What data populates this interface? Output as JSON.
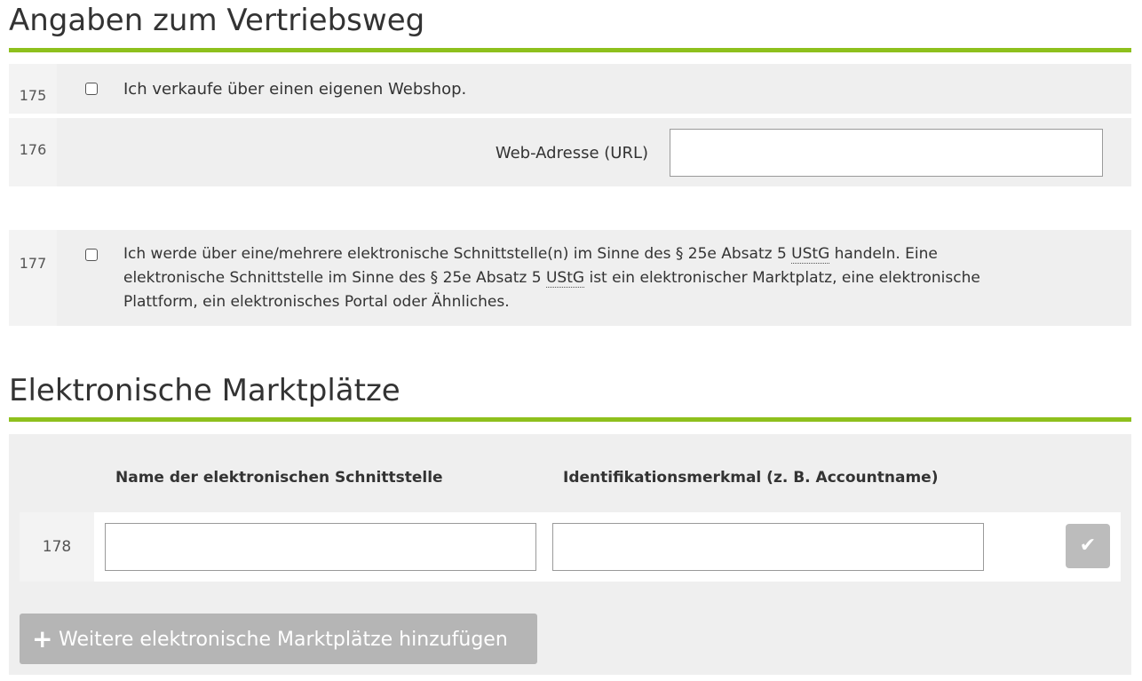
{
  "section1": {
    "title": "Angaben zum Vertriebsweg",
    "rows": [
      {
        "number": "175",
        "label": "Ich verkaufe über einen eigenen Webshop.",
        "checked": false
      },
      {
        "number": "176",
        "label": "Web-Adresse (URL)",
        "value": ""
      },
      {
        "number": "177",
        "label_part1": "Ich werde über eine/mehrere elektronische Schnittstelle(n) im Sinne des § 25e Absatz 5",
        "abbr1": "UStG",
        "label_part2": "handeln. Eine",
        "label_part3": "elektronische Schnittstelle im Sinne des § 25e Absatz 5",
        "abbr2": "UStG",
        "label_part4": "ist ein elektronischer Marktplatz, eine elektronische",
        "label_part5": "Plattform, ein elektronisches Portal oder Ähnliches.",
        "checked": false
      }
    ]
  },
  "section2": {
    "title": "Elektronische Marktplätze",
    "columns": [
      "Name der elektronischen Schnittstelle",
      "Identifikationsmerkmal (z. B. Accountname)"
    ],
    "rows": [
      {
        "number": "178",
        "name": "",
        "identifier": ""
      }
    ],
    "confirm_icon": "checkmark-icon",
    "add_button": {
      "icon": "plus-icon",
      "label": "Weitere elektronische Marktplätze hinzufügen"
    }
  },
  "colors": {
    "accent": "#8ec01d",
    "row_bg": "#efefef",
    "button_disabled": "#b5b5b5"
  }
}
